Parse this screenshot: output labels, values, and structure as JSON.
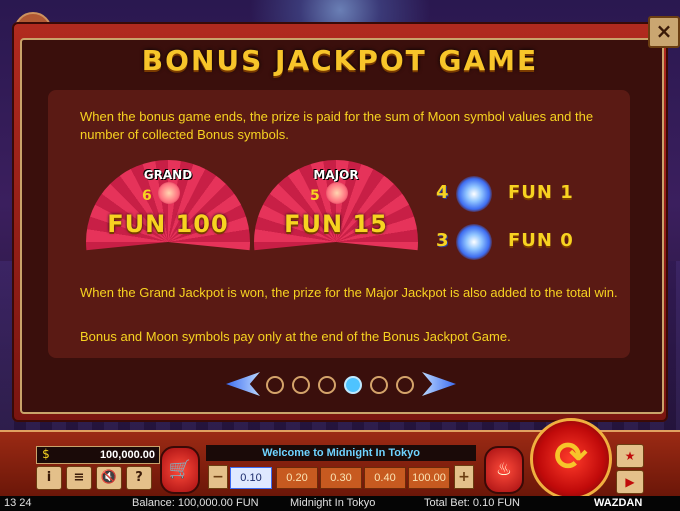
{
  "screen": {
    "title": "BONUS JACKPOT GAME",
    "close_label": "×",
    "text1": "When the bonus game ends, the prize is paid for the sum of Moon symbol values and the number of collected Bonus symbols.",
    "text2": "When the Grand Jackpot is won, the prize for the Major Jackpot is also added to the total win.",
    "text3": "Bonus and Moon symbols pay only at the end of the Bonus Jackpot Game."
  },
  "jackpots": [
    {
      "label": "GRAND",
      "count": "6",
      "amount": "FUN 100"
    },
    {
      "label": "MAJOR",
      "count": "5",
      "amount": "FUN 15"
    }
  ],
  "rewards": [
    {
      "count": "4",
      "value": "FUN 1"
    },
    {
      "count": "3",
      "value": "FUN 0"
    }
  ],
  "pager": {
    "pages": 6,
    "active_index": 3
  },
  "bar": {
    "balance_value": "100,000.00",
    "message": "Welcome to Midnight In Tokyo",
    "bets": [
      "0.10",
      "0.20",
      "0.30",
      "0.40",
      "100.00"
    ],
    "selected_bet": "0.10",
    "info_label": "i",
    "menu_label": "≡",
    "sound_label": "🔇",
    "help_label": "?",
    "minus_label": "−",
    "plus_label": "+"
  },
  "status": {
    "time": "13 24",
    "balance": "Balance: 100,000.00 FUN",
    "game": "Midnight In Tokyo",
    "total_bet": "Total Bet: 0.10 FUN",
    "brand": "WAZDAN"
  },
  "colors": {
    "gold": "#f7d321",
    "fan_red": "#e6335a",
    "active_dot": "#4ec3ff"
  },
  "icons": [
    "close-icon",
    "menu-icon",
    "cart-icon",
    "spin-icon",
    "bonus-symbol-icon",
    "coin-icon"
  ]
}
